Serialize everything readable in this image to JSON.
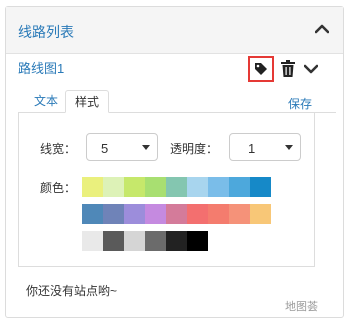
{
  "panel": {
    "title": "线路列表"
  },
  "route": {
    "name": "路线图1",
    "icons": {
      "tag": "tag-icon",
      "trash": "trash-icon",
      "chevron": "chevron-down-icon",
      "collapse": "chevron-up-icon"
    }
  },
  "tabs": {
    "text": "文本",
    "style": "样式",
    "active": "样式"
  },
  "save_label": "保存",
  "style": {
    "line_width_label": "线宽：",
    "line_width_value": "5",
    "opacity_label": "透明度：",
    "opacity_value": "1",
    "color_label": "颜色："
  },
  "palette": {
    "row1": [
      "#eaf07d",
      "#ddf2b7",
      "#c6e86b",
      "#a8df71",
      "#84c6b0",
      "#a8d5ee",
      "#7abde9",
      "#4da8dc",
      "#1689c8"
    ],
    "row2": [
      "#4f88b8",
      "#6f83b8",
      "#9c8ddb",
      "#c58ae0",
      "#d47b9a",
      "#f36f6f",
      "#f47c6e",
      "#f59279",
      "#f8c777"
    ],
    "row3": [
      "#e9e9e9",
      "#5a5a5a",
      "#d5d5d5",
      "#6b6b6b",
      "#222222",
      "#000000"
    ]
  },
  "empty_message": "你还没有站点哟~",
  "watermark": "地图荟"
}
